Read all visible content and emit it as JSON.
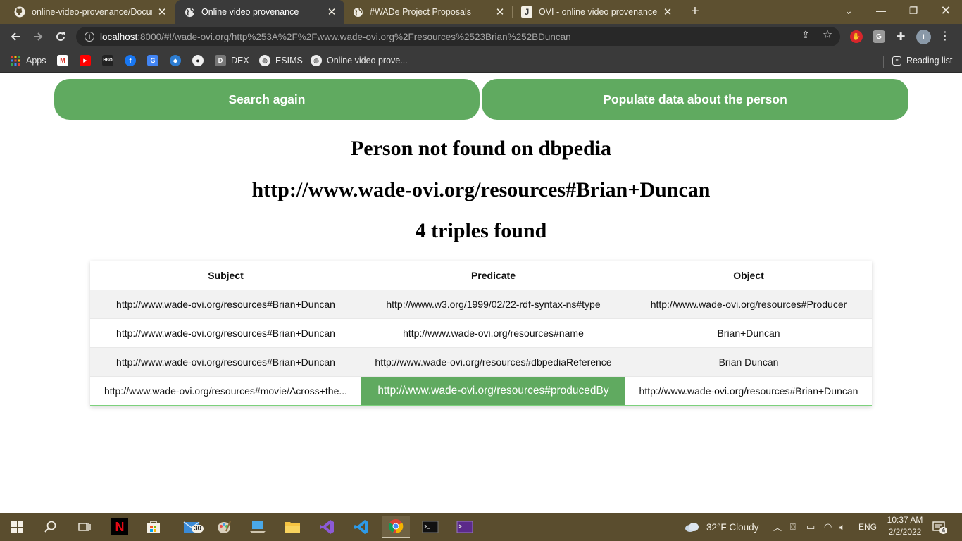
{
  "browser": {
    "tabs": [
      {
        "title": "online-video-provenance/Docum",
        "icon": "github-icon"
      },
      {
        "title": "Online video provenance",
        "icon": "globe-icon",
        "active": true
      },
      {
        "title": "#WADe Project Proposals",
        "icon": "globe-icon"
      },
      {
        "title": "OVI - online video provenance - ",
        "icon": "j-icon"
      }
    ],
    "url_host": "localhost",
    "url_rest": ":8000/#!/wade-ovi.org/http%253A%2F%2Fwww.wade-ovi.org%2Fresources%2523Brian%252BDuncan",
    "bookmarks": {
      "apps": "Apps",
      "dex": "DEX",
      "esims": "ESIMS",
      "ovp": "Online video prove...",
      "reading_list": "Reading list"
    }
  },
  "page": {
    "search_again_label": "Search again",
    "populate_label": "Populate data about the person",
    "heading_not_found": "Person not found on dbpedia",
    "heading_uri": "http://www.wade-ovi.org/resources#Brian+Duncan",
    "heading_count": "4 triples found",
    "table": {
      "headers": [
        "Subject",
        "Predicate",
        "Object"
      ],
      "rows": [
        [
          "http://www.wade-ovi.org/resources#Brian+Duncan",
          "http://www.w3.org/1999/02/22-rdf-syntax-ns#type",
          "http://www.wade-ovi.org/resources#Producer"
        ],
        [
          "http://www.wade-ovi.org/resources#Brian+Duncan",
          "http://www.wade-ovi.org/resources#name",
          "Brian+Duncan"
        ],
        [
          "http://www.wade-ovi.org/resources#Brian+Duncan",
          "http://www.wade-ovi.org/resources#dbpediaReference",
          "Brian Duncan"
        ],
        [
          "http://www.wade-ovi.org/resources#movie/Across+the...",
          "http://www.wade-ovi.org/resources#producedBy",
          "http://www.wade-ovi.org/resources#Brian+Duncan"
        ]
      ]
    },
    "accent_color": "#60aa60"
  },
  "taskbar": {
    "mail_badge": "30",
    "weather": "32°F  Cloudy",
    "language": "ENG",
    "time": "10:37 AM",
    "date": "2/2/2022",
    "notifications": "4"
  }
}
